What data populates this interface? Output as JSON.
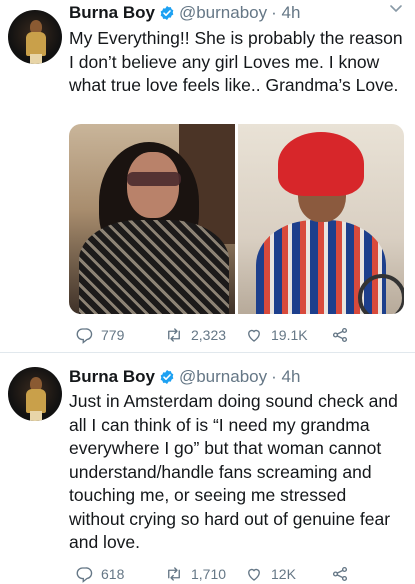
{
  "tweets": [
    {
      "name": "Burna Boy",
      "handle": "@burnaboy",
      "time": "· 4h",
      "text": "My Everything!!  She is probably the reason I don’t believe any girl Loves me. I know what true love feels like.. Grandma’s Love.",
      "replies": "779",
      "retweets": "2,323",
      "likes": "19.1K",
      "has_media": true
    },
    {
      "name": "Burna Boy",
      "handle": "@burnaboy",
      "time": "· 4h",
      "text": "Just in Amsterdam doing sound check and all I can think of is “I need my grandma everywhere I go” but that woman cannot understand/handle fans screaming and touching me, or seeing me stressed without crying so hard out of genuine fear and love.",
      "replies": "618",
      "retweets": "1,710",
      "likes": "12K",
      "has_media": false
    }
  ],
  "colors": {
    "verified": "#1da1f2",
    "secondary_text": "#657786",
    "divider": "#e1e8ed"
  },
  "icons": [
    "verified-badge-icon",
    "chevron-down-icon",
    "reply-icon",
    "retweet-icon",
    "like-icon",
    "share-icon"
  ]
}
